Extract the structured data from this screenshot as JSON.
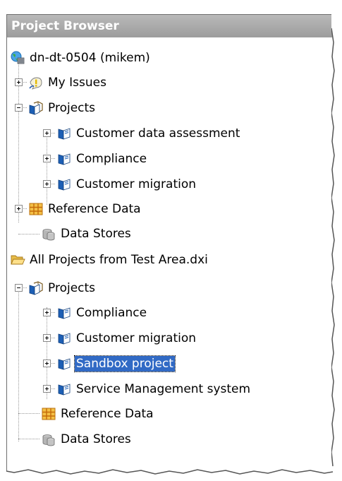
{
  "panel": {
    "title": "Project Browser"
  },
  "tree": {
    "server": {
      "label": "dn-dt-0504 (mikem)",
      "icon": "server-globe-icon"
    },
    "my_issues": {
      "label": "My Issues",
      "icon": "issues-icon"
    },
    "projects1": {
      "label": "Projects",
      "icon": "projects-folder-icon"
    },
    "p1_customer_data_assessment": {
      "label": "Customer data assessment",
      "icon": "project-book-icon"
    },
    "p1_compliance": {
      "label": "Compliance",
      "icon": "project-book-icon"
    },
    "p1_customer_migration": {
      "label": "Customer migration",
      "icon": "project-book-icon"
    },
    "reference_data1": {
      "label": "Reference Data",
      "icon": "reference-data-grid-icon"
    },
    "data_stores1": {
      "label": "Data Stores",
      "icon": "data-stores-icon"
    },
    "dxi_file": {
      "label": "All Projects from Test Area.dxi",
      "icon": "open-folder-icon"
    },
    "projects2": {
      "label": "Projects",
      "icon": "projects-folder-icon"
    },
    "p2_compliance": {
      "label": "Compliance",
      "icon": "project-book-icon"
    },
    "p2_customer_migration": {
      "label": "Customer migration",
      "icon": "project-book-icon"
    },
    "p2_sandbox_project": {
      "label": "Sandbox project",
      "icon": "project-book-icon",
      "selected": true
    },
    "p2_service_management_system": {
      "label": "Service Management system",
      "icon": "project-book-icon"
    },
    "reference_data2": {
      "label": "Reference Data",
      "icon": "reference-data-grid-icon"
    },
    "data_stores2": {
      "label": "Data Stores",
      "icon": "data-stores-icon"
    }
  },
  "colors": {
    "title_bar": "#a8a8a8",
    "selection": "#316ac5",
    "book_blue": "#1d5fb5"
  }
}
